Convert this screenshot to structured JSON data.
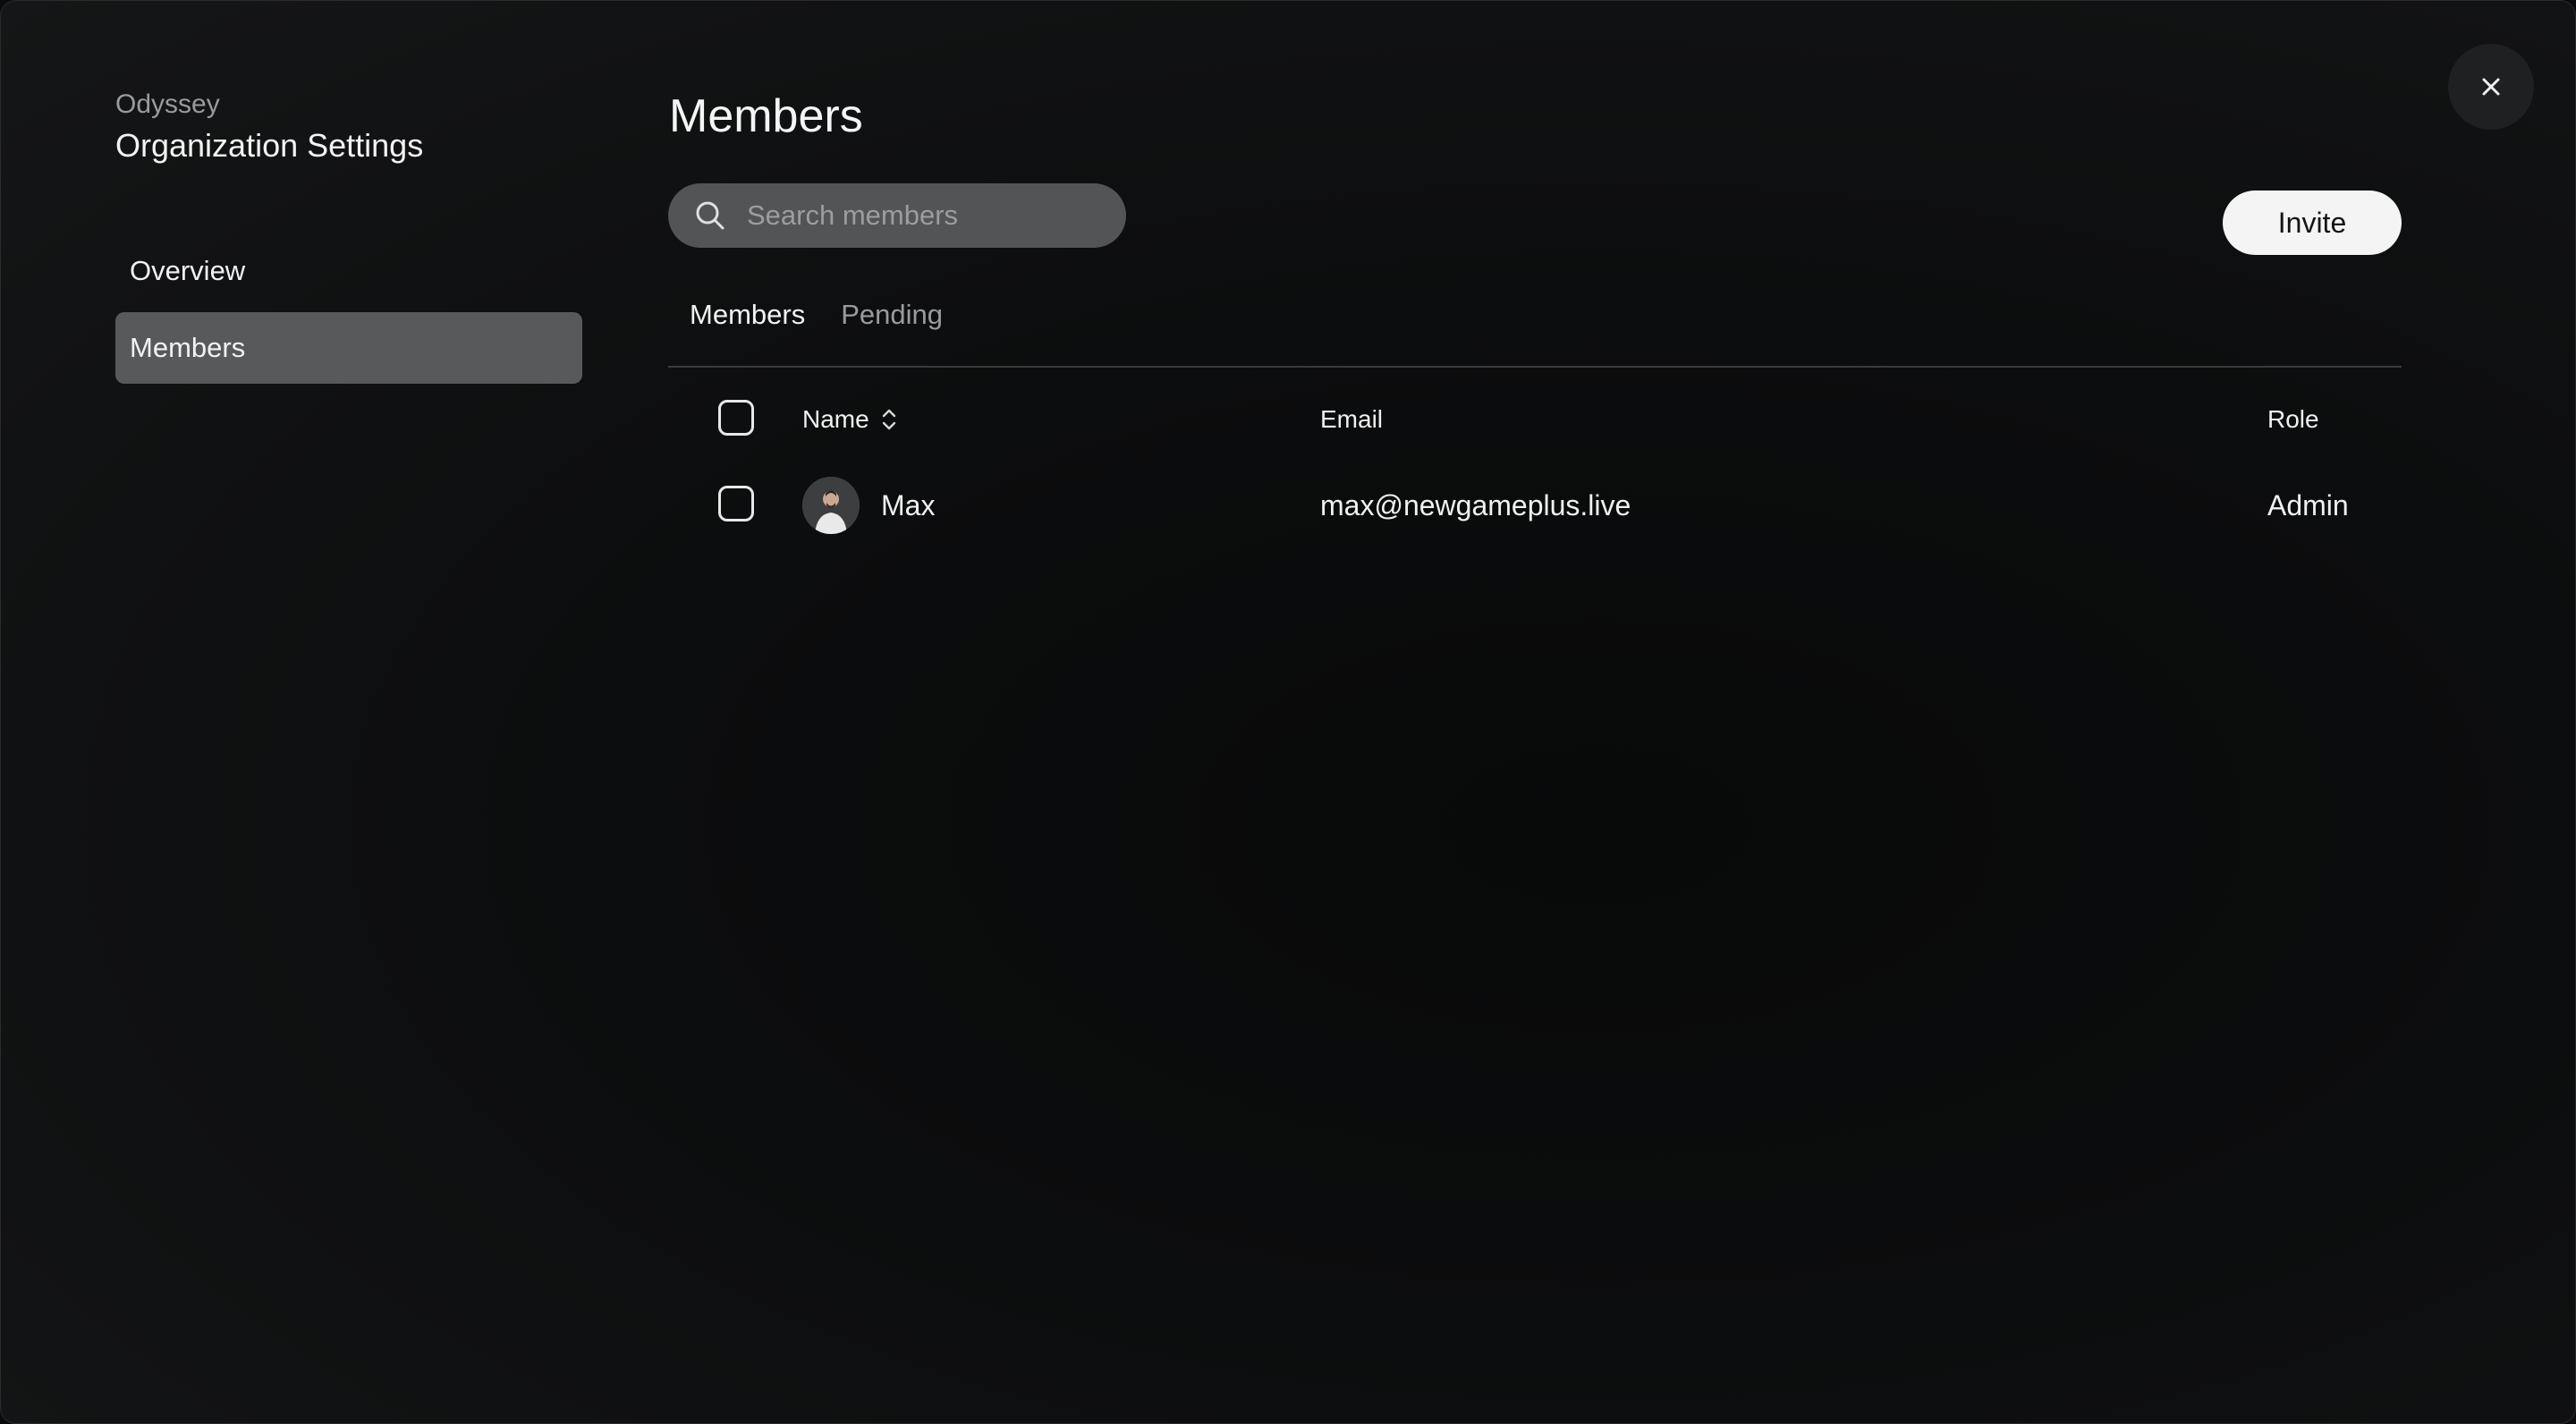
{
  "sidebar": {
    "org_name": "Odyssey",
    "title": "Organization Settings",
    "items": [
      {
        "label": "Overview",
        "active": false
      },
      {
        "label": "Members",
        "active": true
      }
    ]
  },
  "main": {
    "title": "Members",
    "search": {
      "placeholder": "Search members",
      "value": ""
    },
    "invite_label": "Invite",
    "tabs": [
      {
        "label": "Members",
        "active": true
      },
      {
        "label": "Pending",
        "active": false
      }
    ],
    "table": {
      "columns": {
        "name": "Name",
        "email": "Email",
        "role": "Role"
      },
      "rows": [
        {
          "name": "Max",
          "email": "max@newgameplus.live",
          "role": "Admin",
          "checked": false
        }
      ]
    }
  },
  "icons": {
    "search": "search-icon",
    "sort": "sort-icon",
    "close": "close-icon",
    "avatar": "avatar"
  },
  "colors": {
    "background": "#0c0d0e",
    "active_nav": "#58595b",
    "search_bg": "#535456",
    "invite_bg": "#f4f4f4"
  }
}
